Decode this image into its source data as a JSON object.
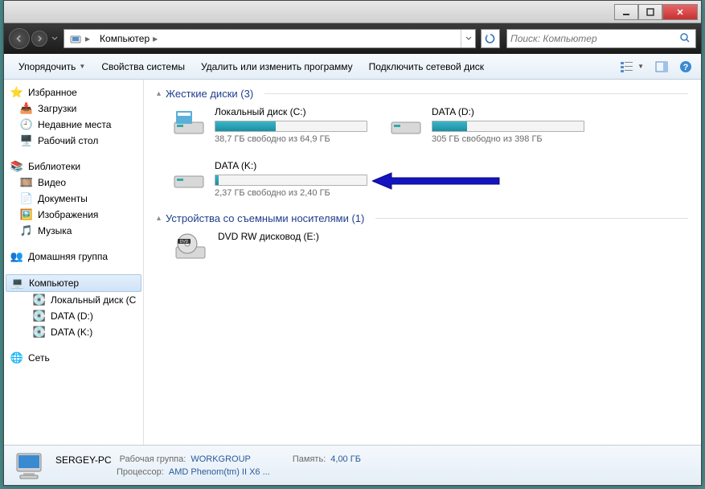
{
  "titlebar": {},
  "breadcrumb": {
    "items": [
      "Компьютер"
    ]
  },
  "search": {
    "placeholder": "Поиск: Компьютер"
  },
  "toolbar": {
    "organize": "Упорядочить",
    "properties": "Свойства системы",
    "uninstall": "Удалить или изменить программу",
    "map_drive": "Подключить сетевой диск"
  },
  "sidebar": {
    "favorites": {
      "label": "Избранное",
      "items": [
        {
          "label": "Загрузки",
          "icon": "download"
        },
        {
          "label": "Недавние места",
          "icon": "recent"
        },
        {
          "label": "Рабочий стол",
          "icon": "desktop"
        }
      ]
    },
    "libraries": {
      "label": "Библиотеки",
      "items": [
        {
          "label": "Видео",
          "icon": "video"
        },
        {
          "label": "Документы",
          "icon": "doc"
        },
        {
          "label": "Изображения",
          "icon": "image"
        },
        {
          "label": "Музыка",
          "icon": "music"
        }
      ]
    },
    "homegroup": {
      "label": "Домашняя группа"
    },
    "computer": {
      "label": "Компьютер",
      "items": [
        {
          "label": "Локальный диск (C"
        },
        {
          "label": "DATA (D:)"
        },
        {
          "label": "DATA (K:)"
        }
      ]
    },
    "network": {
      "label": "Сеть"
    }
  },
  "content": {
    "hdd": {
      "title": "Жесткие диски (3)",
      "drives": [
        {
          "name": "Локальный диск (C:)",
          "free_text": "38,7 ГБ свободно из 64,9 ГБ",
          "fill_pct": 40
        },
        {
          "name": "DATA (D:)",
          "free_text": "305 ГБ свободно из 398 ГБ",
          "fill_pct": 23
        },
        {
          "name": "DATA (K:)",
          "free_text": "2,37 ГБ свободно из 2,40 ГБ",
          "fill_pct": 2
        }
      ]
    },
    "removable": {
      "title": "Устройства со съемными носителями (1)",
      "drives": [
        {
          "name": "DVD RW дисковод (E:)"
        }
      ]
    }
  },
  "statusbar": {
    "computer_name": "SERGEY-PC",
    "workgroup_label": "Рабочая группа:",
    "workgroup": "WORKGROUP",
    "memory_label": "Память:",
    "memory": "4,00 ГБ",
    "processor_label": "Процессор:",
    "processor": "AMD Phenom(tm) II X6 ..."
  }
}
